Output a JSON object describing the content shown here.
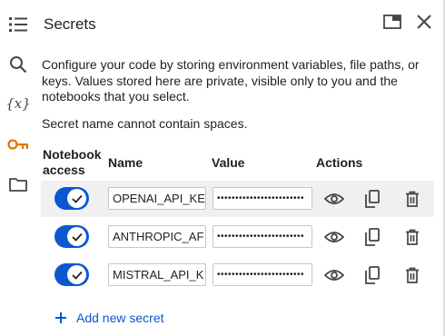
{
  "sidebar": {
    "items": [
      {
        "icon": "list-icon"
      },
      {
        "icon": "search-icon"
      },
      {
        "icon": "variables-icon",
        "glyph": "{x}"
      },
      {
        "icon": "key-icon",
        "active": true
      },
      {
        "icon": "folder-icon"
      }
    ]
  },
  "panel": {
    "title": "Secrets",
    "description": "Configure your code by storing environment variables, file paths, or keys. Values stored here are private, visible only to you and the notebooks that you select.",
    "note": "Secret name cannot contain spaces."
  },
  "table": {
    "headers": {
      "access": "Notebook access",
      "name": "Name",
      "value": "Value",
      "actions": "Actions"
    },
    "rows": [
      {
        "name": "OPENAI_API_KE",
        "value": "••••••••••••••••••••••••",
        "access": true
      },
      {
        "name": "ANTHROPIC_AF",
        "value": "••••••••••••••••••••••••",
        "access": true
      },
      {
        "name": "MISTRAL_API_K",
        "value": "••••••••••••••••••••••••",
        "access": true
      }
    ]
  },
  "add_button": {
    "label": "Add new secret"
  },
  "colors": {
    "accent": "#0b57d0",
    "key_icon": "#e37400",
    "icon": "#444746"
  }
}
